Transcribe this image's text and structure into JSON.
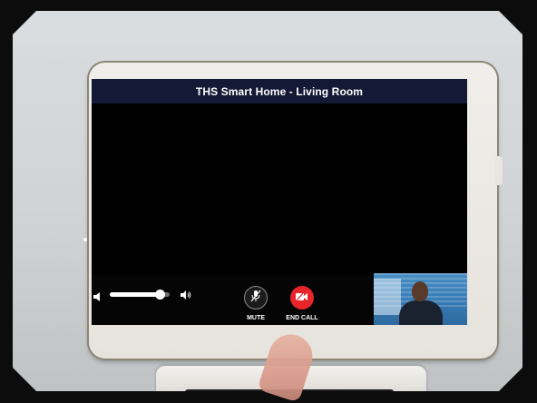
{
  "app": {
    "title": "THS Smart Home - Living Room"
  },
  "volume": {
    "level": 0.84,
    "low_icon": "speaker-low-icon",
    "high_icon": "speaker-high-icon"
  },
  "controls": {
    "mute_label": "MUTE",
    "mute_icon": "microphone-muted-icon",
    "end_call_label": "END CALL",
    "end_call_icon": "video-end-icon"
  },
  "colors": {
    "title_bar": "#141a35",
    "end_call": "#e8262a",
    "screen": "#000000"
  }
}
